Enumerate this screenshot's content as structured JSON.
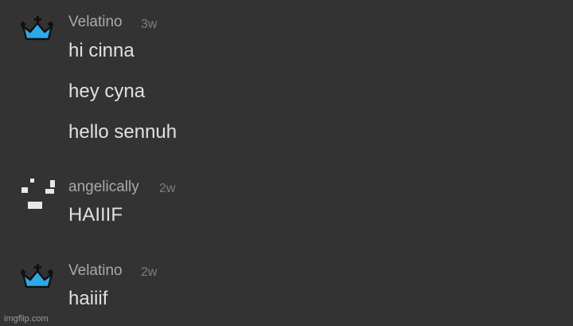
{
  "messages": [
    {
      "username": "Velatino",
      "timestamp": "3w",
      "avatar_icon": "crown-icon",
      "lines": [
        "hi cinna",
        "hey cyna",
        "hello sennuh"
      ]
    },
    {
      "username": "angelically",
      "timestamp": "2w",
      "avatar_icon": "pixel-smile-icon",
      "lines": [
        "HAIIIF"
      ]
    },
    {
      "username": "Velatino",
      "timestamp": "2w",
      "avatar_icon": "crown-icon",
      "lines": [
        "haiiif"
      ]
    }
  ],
  "watermark": "imgflip.com",
  "colors": {
    "background": "#333333",
    "crown_fill": "#2ea8e6",
    "username": "#a9a9a9",
    "timestamp": "#7d7d7d",
    "message_text": "#e0e0e0"
  }
}
